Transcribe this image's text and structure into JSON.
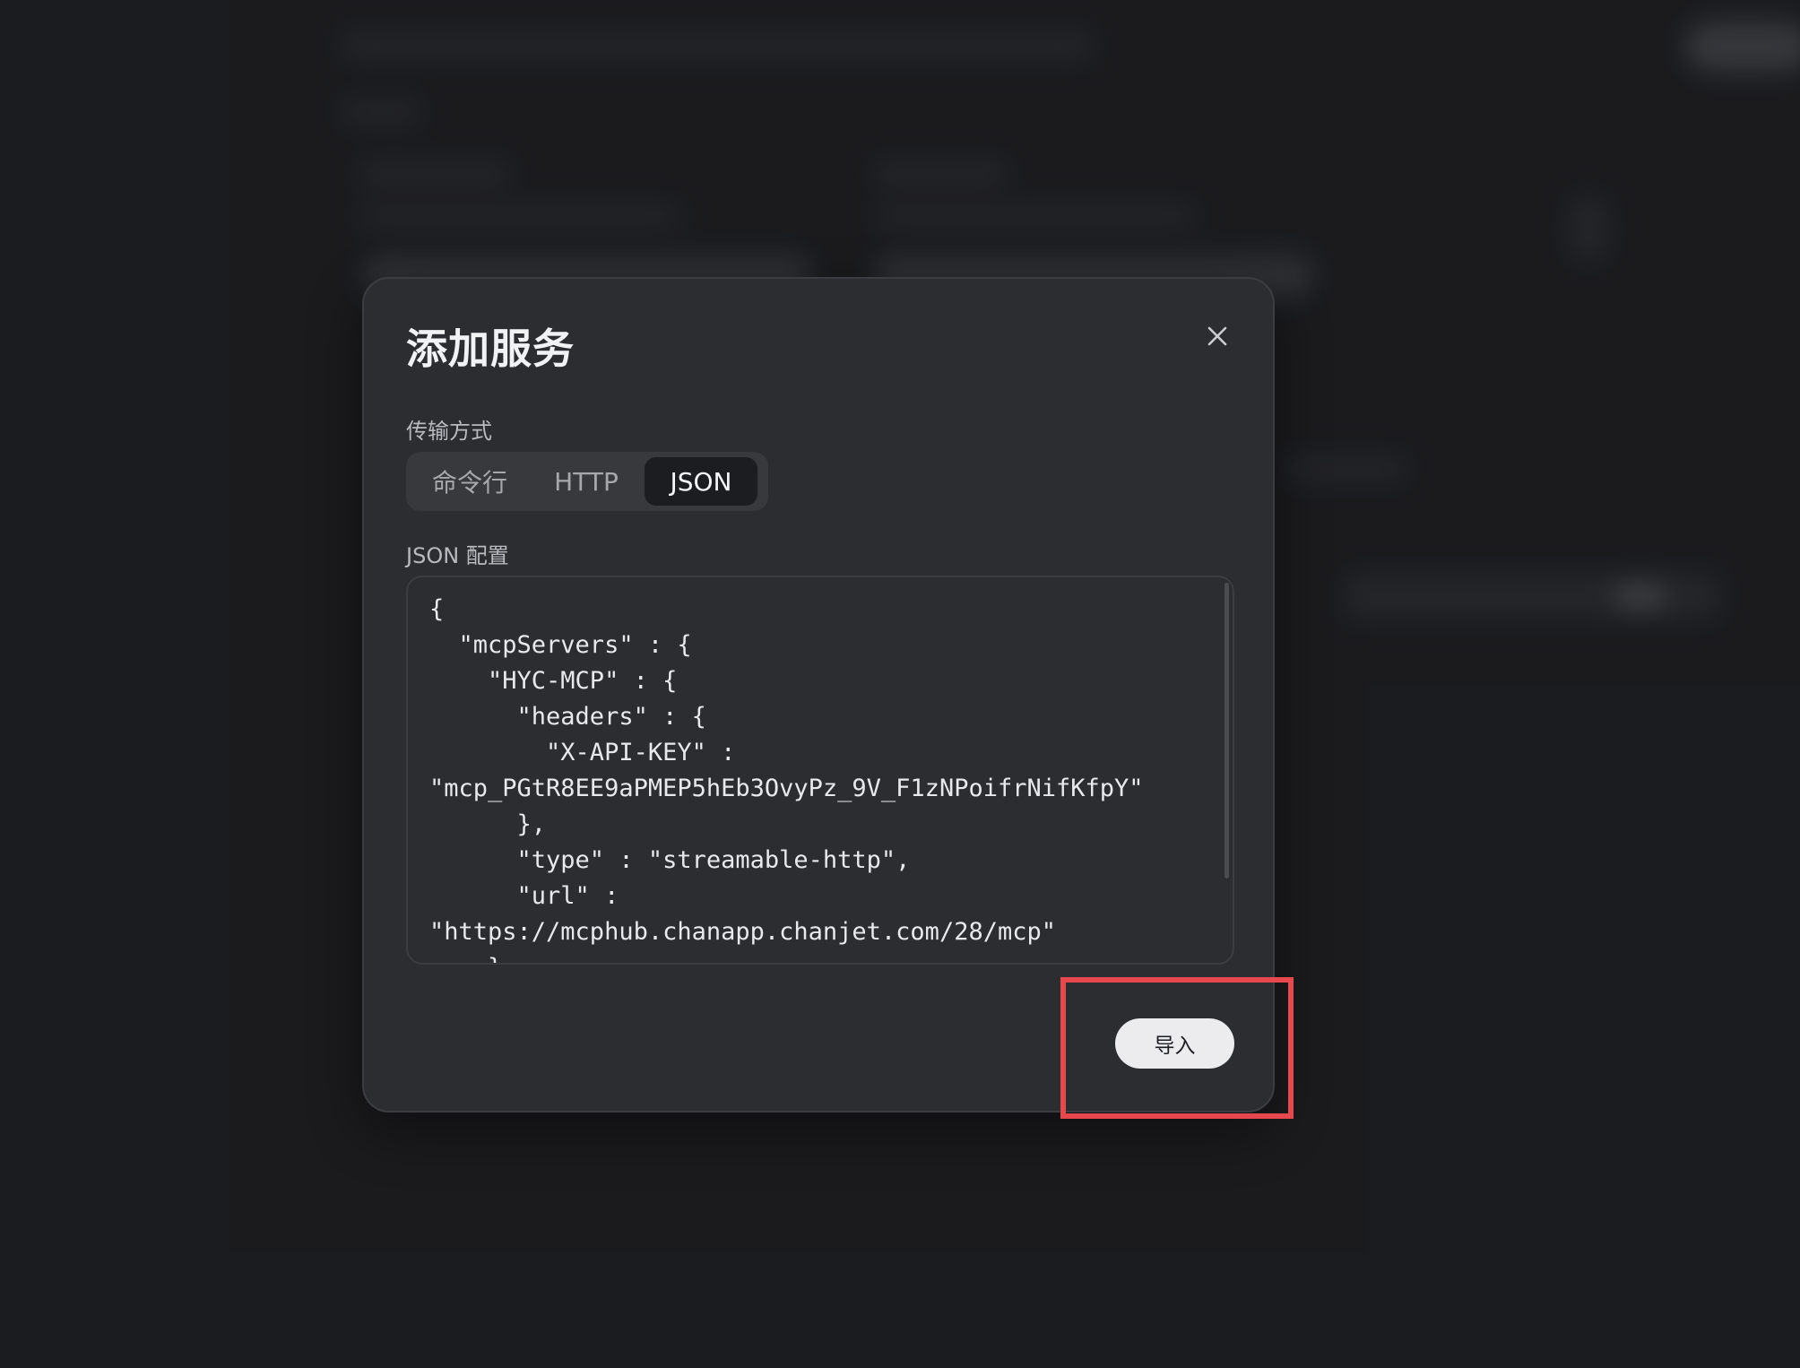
{
  "modal": {
    "title": "添加服务",
    "transport": {
      "label": "传输方式",
      "options": [
        "命令行",
        "HTTP",
        "JSON"
      ],
      "selected": "JSON"
    },
    "json_config": {
      "label": "JSON 配置",
      "content": "{\n  \"mcpServers\" : {\n    \"HYC-MCP\" : {\n      \"headers\" : {\n        \"X-API-KEY\" :\n\"mcp_PGtR8EE9aPMEP5hEb3OvyPz_9V_F1zNPoifrNifKfpY\"\n      },\n      \"type\" : \"streamable-http\",\n      \"url\" :\n\"https://mcphub.chanapp.chanjet.com/28/mcp\"\n    }"
    },
    "import_button": "导入",
    "close_icon": "close-icon"
  },
  "colors": {
    "background": "#202124",
    "modal": "#2b2d31",
    "highlight": "#e5484d"
  }
}
